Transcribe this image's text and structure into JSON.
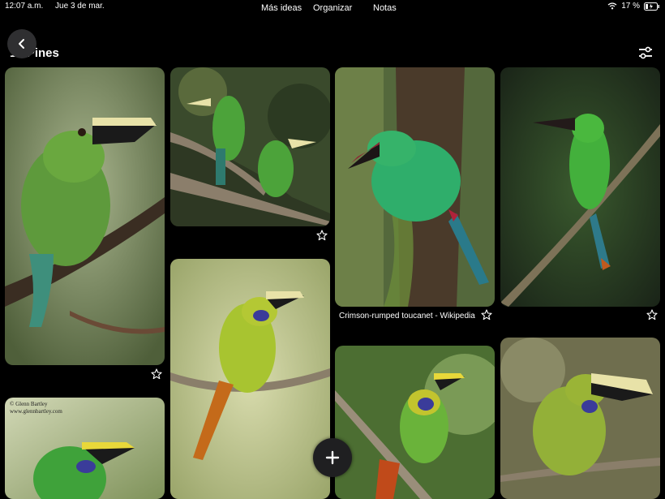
{
  "status": {
    "time": "12:07 a.m.",
    "date": "Jue 3 de mar.",
    "battery": "17 %"
  },
  "tabs": [
    {
      "label": "Más ideas",
      "active": false
    },
    {
      "label": "Organizar",
      "active": true
    },
    {
      "label": "Notas",
      "active": false
    }
  ],
  "board": {
    "title": "16 Pines"
  },
  "pins": [
    {
      "id": 1,
      "caption": ""
    },
    {
      "id": 2,
      "caption": ""
    },
    {
      "id": 3,
      "caption": "Crimson-rumped toucanet - Wikipedia"
    },
    {
      "id": 4,
      "caption": ""
    },
    {
      "id": 5,
      "caption": ""
    },
    {
      "id": 6,
      "caption": "",
      "watermark_line1": "© Glenn Bartley",
      "watermark_line2": "www.glennbartley.com"
    },
    {
      "id": 7,
      "caption": ""
    },
    {
      "id": 8,
      "caption": ""
    }
  ],
  "icons": {
    "back": "chevron-left-icon",
    "filter": "sliders-icon",
    "save": "star-outline-icon",
    "add": "plus-icon",
    "wifi": "wifi-icon",
    "battery": "battery-charging-icon"
  },
  "colors": {
    "background": "#000000",
    "button": "#2f2f31",
    "text": "#ffffff"
  }
}
